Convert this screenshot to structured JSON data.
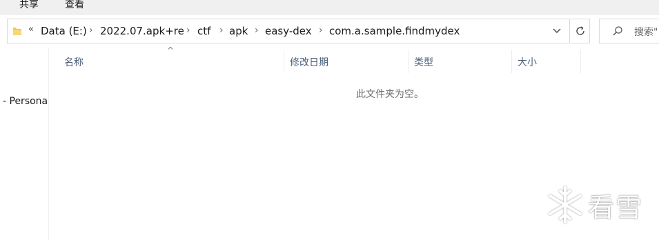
{
  "ribbon": {
    "tabs": [
      "共享",
      "查看"
    ]
  },
  "address": {
    "overflow": "«",
    "crumbs": [
      "Data (E:)",
      "2022.07.apk+re",
      "ctf",
      "apk",
      "easy-dex",
      "com.a.sample.findmydex"
    ]
  },
  "search": {
    "placeholder": "搜索\""
  },
  "nav": {
    "item": "- Persona"
  },
  "columns": [
    "名称",
    "修改日期",
    "类型",
    "大小"
  ],
  "empty_message": "此文件夹为空。",
  "watermark": {
    "text": "看雪"
  }
}
